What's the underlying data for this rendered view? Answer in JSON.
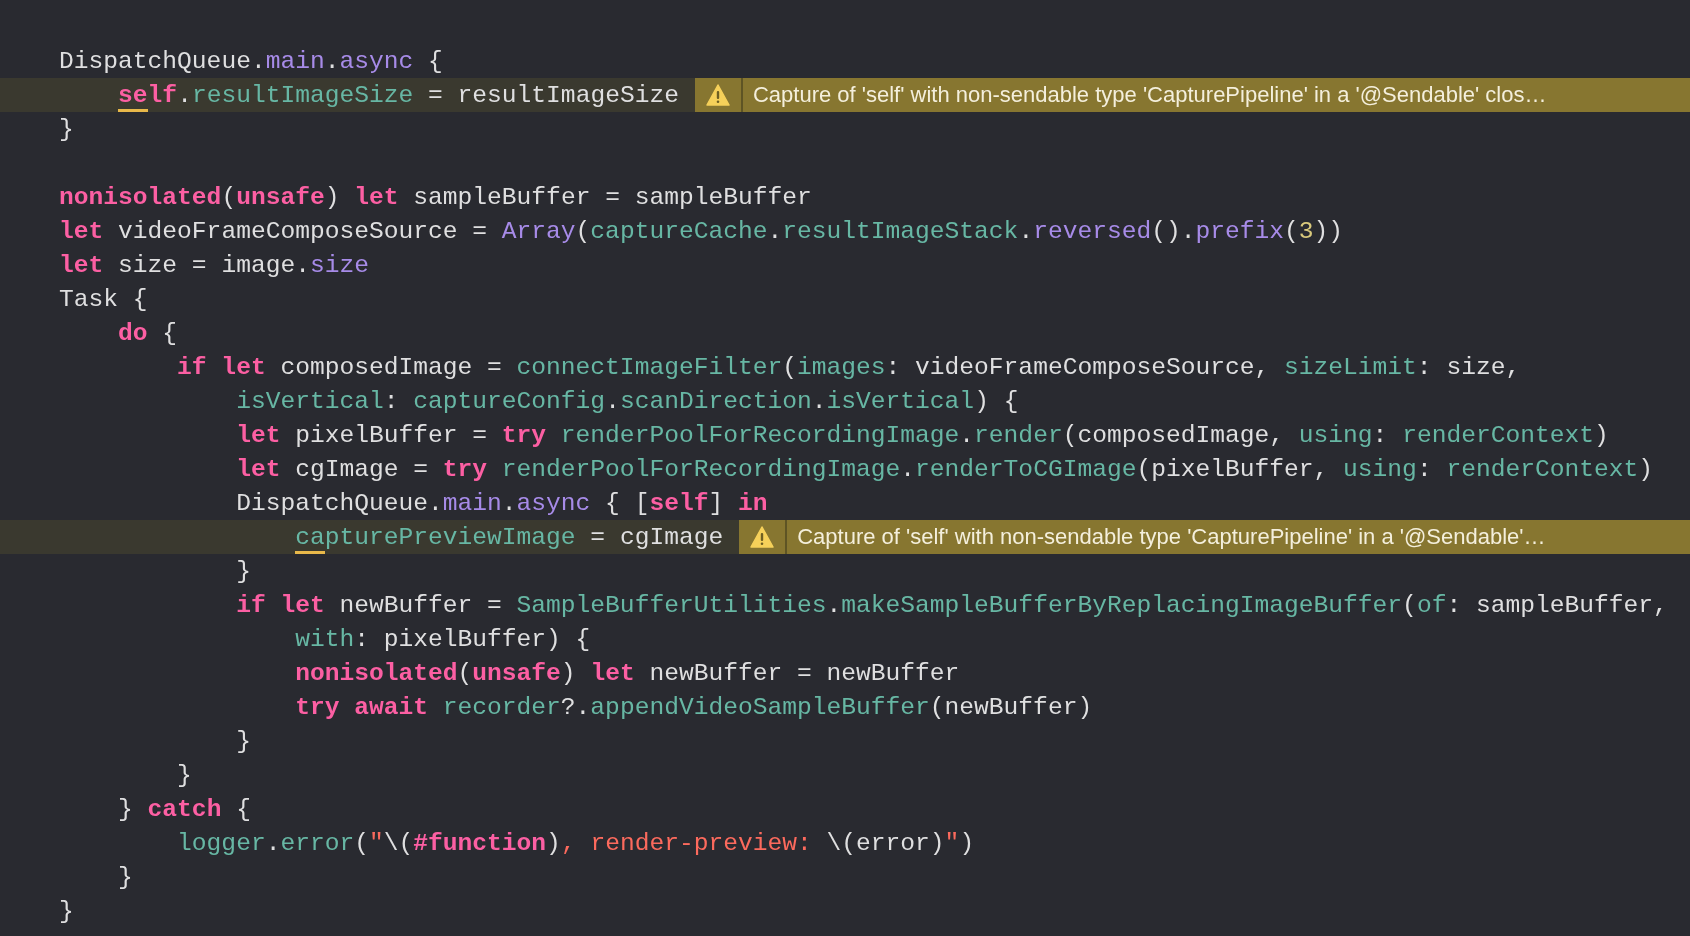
{
  "editor": {
    "lines": [
      {
        "kind": "blank"
      },
      {
        "kind": "code",
        "tokens": [
          {
            "text": "DispatchQueue.",
            "kind": "plain"
          },
          {
            "text": "main",
            "kind": "sys"
          },
          {
            "text": ".",
            "kind": "plain"
          },
          {
            "text": "async",
            "kind": "sys"
          },
          {
            "text": " {",
            "kind": "plain"
          }
        ],
        "children": [
          {
            "kind": "code",
            "tokens": [
              {
                "text": "se",
                "kind": "kw",
                "underline": true
              },
              {
                "text": "lf",
                "kind": "kw"
              },
              {
                "text": ".",
                "kind": "plain"
              },
              {
                "text": "resultImageSize",
                "kind": "proj"
              },
              {
                "text": " = resultImageSize",
                "kind": "plain"
              }
            ],
            "warning": {
              "message": "Capture of 'self' with non-sendable type 'CapturePipeline' in a '@Sendable' clos…"
            }
          }
        ]
      },
      {
        "kind": "code",
        "tokens": [
          {
            "text": "}",
            "kind": "plain"
          }
        ]
      },
      {
        "kind": "blank"
      },
      {
        "kind": "code",
        "tokens": [
          {
            "text": "nonisolated",
            "kind": "kw"
          },
          {
            "text": "(",
            "kind": "plain"
          },
          {
            "text": "unsafe",
            "kind": "kw"
          },
          {
            "text": ") ",
            "kind": "plain"
          },
          {
            "text": "let",
            "kind": "kw"
          },
          {
            "text": " sampleBuffer = sampleBuffer",
            "kind": "plain"
          }
        ]
      },
      {
        "kind": "code",
        "tokens": [
          {
            "text": "let",
            "kind": "kw"
          },
          {
            "text": " videoFrameComposeSource = ",
            "kind": "plain"
          },
          {
            "text": "Array",
            "kind": "sys"
          },
          {
            "text": "(",
            "kind": "plain"
          },
          {
            "text": "captureCache",
            "kind": "proj"
          },
          {
            "text": ".",
            "kind": "plain"
          },
          {
            "text": "resultImageStack",
            "kind": "proj"
          },
          {
            "text": ".",
            "kind": "plain"
          },
          {
            "text": "reversed",
            "kind": "sys"
          },
          {
            "text": "().",
            "kind": "plain"
          },
          {
            "text": "prefix",
            "kind": "sys"
          },
          {
            "text": "(",
            "kind": "plain"
          },
          {
            "text": "3",
            "kind": "num"
          },
          {
            "text": "))",
            "kind": "plain"
          }
        ]
      },
      {
        "kind": "code",
        "tokens": [
          {
            "text": "let",
            "kind": "kw"
          },
          {
            "text": " size = image.",
            "kind": "plain"
          },
          {
            "text": "size",
            "kind": "sys"
          }
        ]
      },
      {
        "kind": "code",
        "tokens": [
          {
            "text": "Task {",
            "kind": "plain"
          }
        ],
        "children": [
          {
            "kind": "code",
            "tokens": [
              {
                "text": "do",
                "kind": "kw"
              },
              {
                "text": " {",
                "kind": "plain"
              }
            ],
            "children": [
              {
                "kind": "code",
                "tokens": [
                  {
                    "text": "if let",
                    "kind": "kw"
                  },
                  {
                    "text": " composedImage = ",
                    "kind": "plain"
                  },
                  {
                    "text": "connectImageFilter",
                    "kind": "proj"
                  },
                  {
                    "text": "(",
                    "kind": "plain"
                  },
                  {
                    "text": "images",
                    "kind": "proj"
                  },
                  {
                    "text": ": videoFrameComposeSource, ",
                    "kind": "plain"
                  },
                  {
                    "text": "sizeLimit",
                    "kind": "proj"
                  },
                  {
                    "text": ": size,",
                    "kind": "plain"
                  }
                ],
                "children": [
                  {
                    "kind": "code",
                    "tokens": [
                      {
                        "text": "isVertical",
                        "kind": "proj"
                      },
                      {
                        "text": ": ",
                        "kind": "plain"
                      },
                      {
                        "text": "captureConfig",
                        "kind": "proj"
                      },
                      {
                        "text": ".",
                        "kind": "plain"
                      },
                      {
                        "text": "scanDirection",
                        "kind": "proj"
                      },
                      {
                        "text": ".",
                        "kind": "plain"
                      },
                      {
                        "text": "isVertical",
                        "kind": "proj"
                      },
                      {
                        "text": ") {",
                        "kind": "plain"
                      }
                    ]
                  },
                  {
                    "kind": "code",
                    "tokens": [
                      {
                        "text": "let",
                        "kind": "kw"
                      },
                      {
                        "text": " pixelBuffer = ",
                        "kind": "plain"
                      },
                      {
                        "text": "try",
                        "kind": "kw"
                      },
                      {
                        "text": " renderPoolForRecordingImage",
                        "kind": "proj"
                      },
                      {
                        "text": ".",
                        "kind": "plain"
                      },
                      {
                        "text": "render",
                        "kind": "proj"
                      },
                      {
                        "text": "(composedImage, ",
                        "kind": "plain"
                      },
                      {
                        "text": "using",
                        "kind": "proj"
                      },
                      {
                        "text": ": ",
                        "kind": "plain"
                      },
                      {
                        "text": "renderContext",
                        "kind": "proj"
                      },
                      {
                        "text": ")",
                        "kind": "plain"
                      }
                    ]
                  },
                  {
                    "kind": "code",
                    "tokens": [
                      {
                        "text": "let",
                        "kind": "kw"
                      },
                      {
                        "text": " cgImage = ",
                        "kind": "plain"
                      },
                      {
                        "text": "try",
                        "kind": "kw"
                      },
                      {
                        "text": " renderPoolForRecordingImage",
                        "kind": "proj"
                      },
                      {
                        "text": ".",
                        "kind": "plain"
                      },
                      {
                        "text": "renderToCGImage",
                        "kind": "proj"
                      },
                      {
                        "text": "(pixelBuffer, ",
                        "kind": "plain"
                      },
                      {
                        "text": "using",
                        "kind": "proj"
                      },
                      {
                        "text": ": ",
                        "kind": "plain"
                      },
                      {
                        "text": "renderContext",
                        "kind": "proj"
                      },
                      {
                        "text": ")",
                        "kind": "plain"
                      }
                    ]
                  },
                  {
                    "kind": "code",
                    "tokens": [
                      {
                        "text": "DispatchQueue.",
                        "kind": "plain"
                      },
                      {
                        "text": "main",
                        "kind": "sys"
                      },
                      {
                        "text": ".",
                        "kind": "plain"
                      },
                      {
                        "text": "async",
                        "kind": "sys"
                      },
                      {
                        "text": " { [",
                        "kind": "plain"
                      },
                      {
                        "text": "self",
                        "kind": "kw"
                      },
                      {
                        "text": "] ",
                        "kind": "plain"
                      },
                      {
                        "text": "in",
                        "kind": "kw"
                      }
                    ],
                    "children": [
                      {
                        "kind": "code",
                        "tokens": [
                          {
                            "text": "ca",
                            "kind": "proj",
                            "underline": true
                          },
                          {
                            "text": "pturePreviewImage",
                            "kind": "proj"
                          },
                          {
                            "text": " = cgImage",
                            "kind": "plain"
                          }
                        ],
                        "warning": {
                          "message": "Capture of 'self' with non-sendable type 'CapturePipeline' in a '@Sendable'…"
                        }
                      }
                    ]
                  },
                  {
                    "kind": "code",
                    "tokens": [
                      {
                        "text": "}",
                        "kind": "plain"
                      }
                    ]
                  },
                  {
                    "kind": "code",
                    "tokens": [
                      {
                        "text": "if let",
                        "kind": "kw"
                      },
                      {
                        "text": " newBuffer = ",
                        "kind": "plain"
                      },
                      {
                        "text": "SampleBufferUtilities",
                        "kind": "proj"
                      },
                      {
                        "text": ".",
                        "kind": "plain"
                      },
                      {
                        "text": "makeSampleBufferByReplacingImageBuffer",
                        "kind": "proj"
                      },
                      {
                        "text": "(",
                        "kind": "plain"
                      },
                      {
                        "text": "of",
                        "kind": "proj"
                      },
                      {
                        "text": ": sampleBuffer,",
                        "kind": "plain"
                      }
                    ],
                    "children": [
                      {
                        "kind": "code",
                        "tokens": [
                          {
                            "text": "with",
                            "kind": "proj"
                          },
                          {
                            "text": ": pixelBuffer) {",
                            "kind": "plain"
                          }
                        ]
                      },
                      {
                        "kind": "code",
                        "tokens": [
                          {
                            "text": "nonisolated",
                            "kind": "kw"
                          },
                          {
                            "text": "(",
                            "kind": "plain"
                          },
                          {
                            "text": "unsafe",
                            "kind": "kw"
                          },
                          {
                            "text": ") ",
                            "kind": "plain"
                          },
                          {
                            "text": "let",
                            "kind": "kw"
                          },
                          {
                            "text": " newBuffer = newBuffer",
                            "kind": "plain"
                          }
                        ]
                      },
                      {
                        "kind": "code",
                        "tokens": [
                          {
                            "text": "try await",
                            "kind": "kw"
                          },
                          {
                            "text": " recorder",
                            "kind": "proj"
                          },
                          {
                            "text": "?.",
                            "kind": "plain"
                          },
                          {
                            "text": "appendVideoSampleBuffer",
                            "kind": "proj"
                          },
                          {
                            "text": "(newBuffer)",
                            "kind": "plain"
                          }
                        ]
                      }
                    ]
                  },
                  {
                    "kind": "code",
                    "tokens": [
                      {
                        "text": "}",
                        "kind": "plain"
                      }
                    ]
                  }
                ]
              },
              {
                "kind": "code",
                "tokens": [
                  {
                    "text": "}",
                    "kind": "plain"
                  }
                ]
              }
            ]
          },
          {
            "kind": "code",
            "tokens": [
              {
                "text": "} ",
                "kind": "plain"
              },
              {
                "text": "catch",
                "kind": "kw"
              },
              {
                "text": " {",
                "kind": "plain"
              }
            ],
            "children": [
              {
                "kind": "code",
                "tokens": [
                  {
                    "text": "logger",
                    "kind": "proj"
                  },
                  {
                    "text": ".",
                    "kind": "plain"
                  },
                  {
                    "text": "error",
                    "kind": "proj"
                  },
                  {
                    "text": "(",
                    "kind": "plain"
                  },
                  {
                    "text": "\"",
                    "kind": "str"
                  },
                  {
                    "text": "\\(",
                    "kind": "plain"
                  },
                  {
                    "text": "#function",
                    "kind": "kw"
                  },
                  {
                    "text": ")",
                    "kind": "plain"
                  },
                  {
                    "text": ", render-preview: ",
                    "kind": "str"
                  },
                  {
                    "text": "\\(error)",
                    "kind": "plain"
                  },
                  {
                    "text": "\"",
                    "kind": "str"
                  },
                  {
                    "text": ")",
                    "kind": "plain"
                  }
                ]
              }
            ]
          },
          {
            "kind": "code",
            "tokens": [
              {
                "text": "}",
                "kind": "plain"
              }
            ]
          }
        ]
      },
      {
        "kind": "code",
        "tokens": [
          {
            "text": "}",
            "kind": "plain"
          }
        ]
      }
    ]
  }
}
